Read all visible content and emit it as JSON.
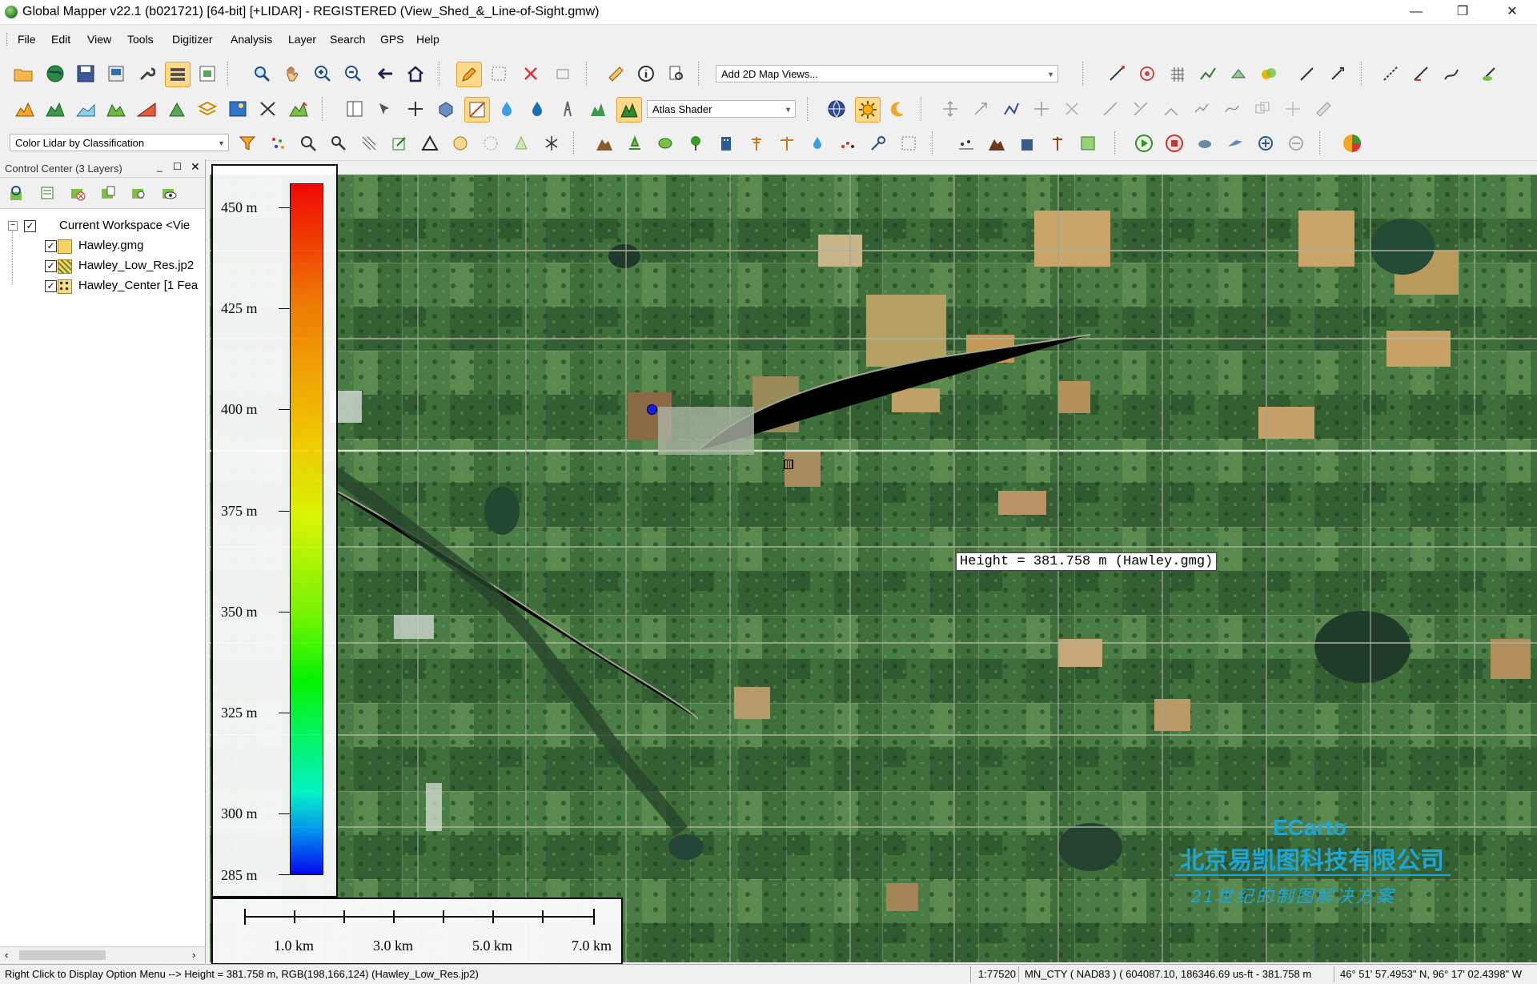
{
  "window": {
    "title": "Global Mapper v22.1 (b021721) [64-bit] [+LIDAR] - REGISTERED (View_Shed_&_Line-of-Sight.gmw)",
    "minimize": "—",
    "restore": "❐",
    "close": "✕"
  },
  "menu": [
    "File",
    "Edit",
    "View",
    "Tools",
    "Digitizer",
    "Analysis",
    "Layer",
    "Search",
    "GPS",
    "Help"
  ],
  "toolbar": {
    "map_views_combo": "Add 2D Map Views...",
    "shader_combo": "Atlas Shader",
    "lidar_combo": "Color Lidar by Classification"
  },
  "control_center": {
    "title": "Control Center (3 Layers)",
    "workspace": "Current Workspace <Vie",
    "layers": [
      {
        "name": "Hawley.gmg",
        "checked": true
      },
      {
        "name": "Hawley_Low_Res.jp2",
        "checked": true
      },
      {
        "name": "Hawley_Center [1 Fea",
        "checked": true
      }
    ]
  },
  "elevation_legend": {
    "labels": [
      "450 m",
      "425 m",
      "400 m",
      "375 m",
      "350 m",
      "325 m",
      "300 m",
      "285 m"
    ]
  },
  "scale_bar": {
    "labels": [
      "1.0 km",
      "3.0 km",
      "5.0 km",
      "7.0 km"
    ]
  },
  "tooltip": "Height = 381.758 m (Hawley.gmg)",
  "watermark": {
    "brand": "ECarto",
    "company": "北京易凯图科技有限公司",
    "slogan": "21世纪的制图解决方案"
  },
  "status": {
    "hint": "Right Click to Display Option Menu --> Height = 381.758 m, RGB(198,166,124) (Hawley_Low_Res.jp2)",
    "scale": "1:77520",
    "projection": "MN_CTY ( NAD83 ) ( 604087.10, 186346.69 us-ft - 381.758 m",
    "coords": "46° 51' 57.4953\" N, 96° 17' 02.4398\" W"
  },
  "colors": {
    "accent_active": "#ffd98a",
    "watermark": "#1ea6d8",
    "map_marker": "#1a1aff"
  }
}
